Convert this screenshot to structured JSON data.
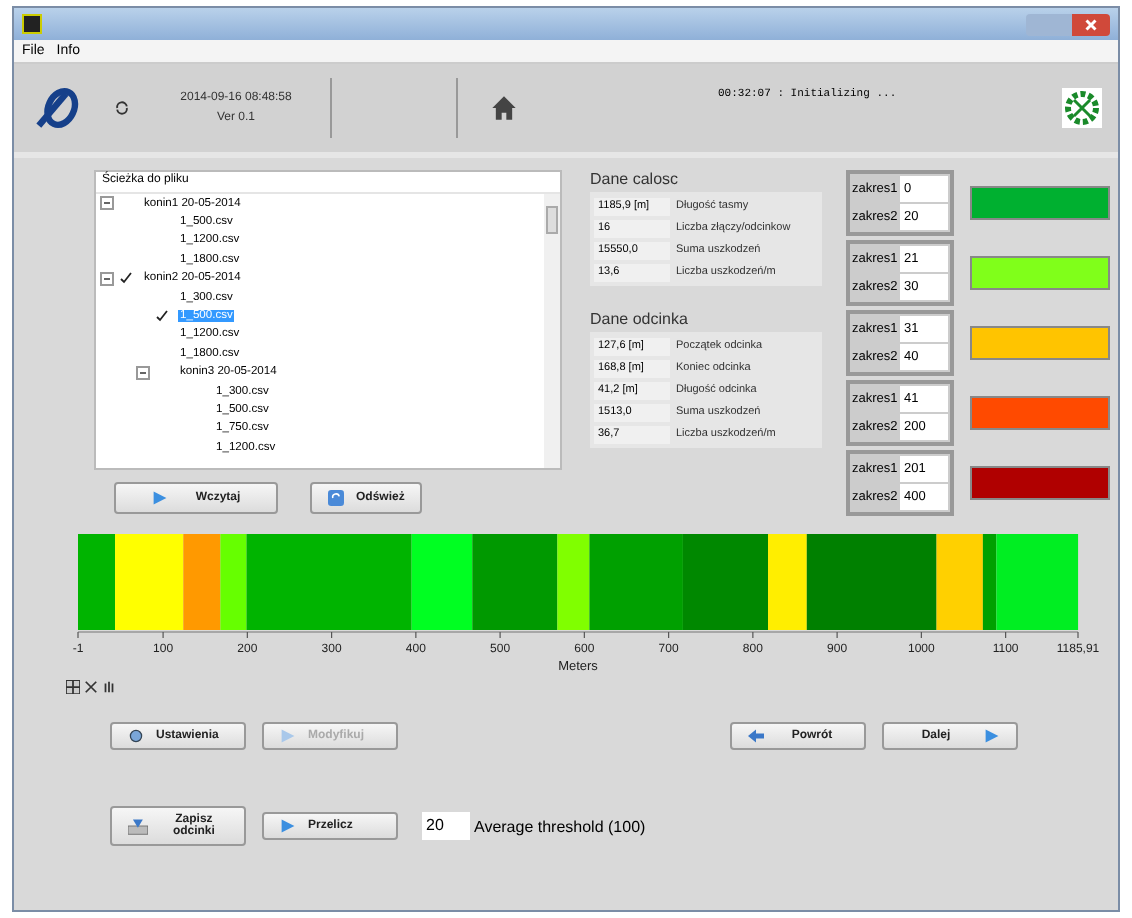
{
  "menu": [
    "File",
    "Info"
  ],
  "toolbar": {
    "date": "2014-09-16 08:48:58",
    "version": "Ver 0.1",
    "status": "00:32:07 : Initializing ..."
  },
  "tree": {
    "header": "Ścieżka do pliku",
    "items": [
      {
        "label": "konin1 20-05-2014",
        "expanded": true,
        "checked": false,
        "selected": false,
        "children": [
          {
            "label": "1_500.csv",
            "checked": false,
            "selected": false
          },
          {
            "label": "1_1200.csv",
            "checked": false,
            "selected": false
          },
          {
            "label": "1_1800.csv",
            "checked": false,
            "selected": false
          }
        ]
      },
      {
        "label": "konin2 20-05-2014",
        "expanded": true,
        "checked": true,
        "selected": false,
        "children": [
          {
            "label": "1_300.csv",
            "checked": false,
            "selected": false
          },
          {
            "label": "1_500.csv",
            "checked": true,
            "selected": true
          },
          {
            "label": "1_1200.csv",
            "checked": false,
            "selected": false
          },
          {
            "label": "1_1800.csv",
            "checked": false,
            "selected": false
          },
          {
            "label": "konin3 20-05-2014",
            "expanded": true,
            "checked": false,
            "selected": false,
            "children": [
              {
                "label": "1_300.csv",
                "checked": false,
                "selected": false
              },
              {
                "label": "1_500.csv",
                "checked": false,
                "selected": false
              },
              {
                "label": "1_750.csv",
                "checked": false,
                "selected": false
              },
              {
                "label": "1_1200.csv",
                "checked": false,
                "selected": false
              }
            ]
          }
        ]
      }
    ]
  },
  "tree_buttons": [
    {
      "label": "Wczytaj",
      "kind": "play"
    },
    {
      "label": "Odśwież",
      "kind": "refresh"
    }
  ],
  "dane_calosc": {
    "title": "Dane calosc",
    "rows": [
      {
        "value": "1185,9 [m]",
        "label": "Długość tasmy"
      },
      {
        "value": "16",
        "label": "Liczba złączy/odcinkow"
      },
      {
        "value": "15550,0",
        "label": "Suma uszkodzeń"
      },
      {
        "value": "13,6",
        "label": "Liczba uszkodzeń/m"
      }
    ]
  },
  "dane_odcinka": {
    "title": "Dane odcinka",
    "rows": [
      {
        "value": "127,6 [m]",
        "label": "Początek odcinka"
      },
      {
        "value": "168,8 [m]",
        "label": "Koniec odcinka"
      },
      {
        "value": "41,2 [m]",
        "label": "Długość odcinka"
      },
      {
        "value": "1513,0",
        "label": "Suma uszkodzeń"
      },
      {
        "value": "36,7",
        "label": "Liczba uszkodzeń/m"
      }
    ]
  },
  "ranges": [
    {
      "label_1": "zakres1",
      "value_1": "0",
      "label_2": "zakres2",
      "value_2": "20",
      "color": "#00b030"
    },
    {
      "label_1": "zakres1",
      "value_1": "21",
      "label_2": "zakres2",
      "value_2": "30",
      "color": "#80ff1a"
    },
    {
      "label_1": "zakres1",
      "value_1": "31",
      "label_2": "zakres2",
      "value_2": "40",
      "color": "#ffc400"
    },
    {
      "label_1": "zakres1",
      "value_1": "41",
      "label_2": "zakres2",
      "value_2": "200",
      "color": "#ff4a00"
    },
    {
      "label_1": "zakres1",
      "value_1": "201",
      "label_2": "zakres2",
      "value_2": "400",
      "color": "#b00000"
    }
  ],
  "chart_data": {
    "type": "bar",
    "orientation": "horizontal",
    "stacked": true,
    "xlabel": "Meters",
    "xlim": [
      -1,
      1185.91
    ],
    "xticks": [
      -1,
      100,
      200,
      300,
      400,
      500,
      600,
      700,
      800,
      900,
      1000,
      1100,
      {
        "value": 1185.91,
        "label": "1185,91"
      }
    ],
    "series": [
      {
        "color": "#00b400",
        "values": [
          44
        ]
      },
      {
        "color": "#ffff00",
        "values": [
          81
        ]
      },
      {
        "color": "#ff9900",
        "values": [
          44
        ]
      },
      {
        "color": "#66ff00",
        "values": [
          31
        ]
      },
      {
        "color": "#00b400",
        "values": [
          196
        ]
      },
      {
        "color": "#00ff22",
        "values": [
          72
        ]
      },
      {
        "color": "#009900",
        "values": [
          101
        ]
      },
      {
        "color": "#80ff00",
        "values": [
          38
        ]
      },
      {
        "color": "#00a000",
        "values": [
          111
        ]
      },
      {
        "color": "#008800",
        "values": [
          101
        ]
      },
      {
        "color": "#ffee00",
        "values": [
          46
        ]
      },
      {
        "color": "#008000",
        "values": [
          154
        ]
      },
      {
        "color": "#ffd000",
        "values": [
          55
        ]
      },
      {
        "color": "#00a000",
        "values": [
          16
        ]
      },
      {
        "color": "#00ee22",
        "values": [
          97
        ]
      }
    ]
  },
  "action_buttons": [
    {
      "label": "Ustawienia",
      "kind": "settings",
      "disabled": false
    },
    {
      "label": "Modyfikuj",
      "kind": "play",
      "disabled": true
    },
    {
      "label": "Powrót",
      "kind": "back",
      "disabled": false
    },
    {
      "label": "Dalej",
      "kind": "next",
      "disabled": false
    }
  ],
  "bottom_buttons": [
    {
      "label": "Zapisz odcinki",
      "kind": "save"
    },
    {
      "label": "Przelicz",
      "kind": "play"
    }
  ],
  "threshold": {
    "value": "20",
    "label": "Average threshold (100)"
  }
}
